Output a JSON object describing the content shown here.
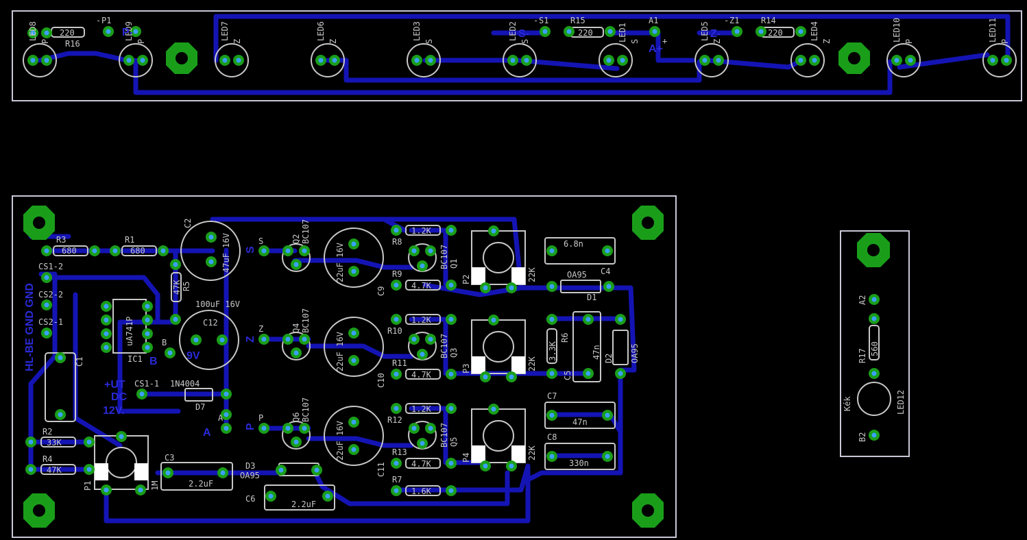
{
  "colors": {
    "background": "#000000",
    "trace": "#1414b4",
    "pad": "#1a9e1a",
    "drill": "#3aa0ff",
    "silk": "#c8c8c8",
    "outline": "#c8c8d8",
    "blue_text": "#2a2ad8"
  },
  "top_board": {
    "labels": {
      "led8": "LED8",
      "led9": "LED9",
      "led7": "LED7",
      "led6": "LED6",
      "led3": "LED3",
      "led2": "LED2",
      "led1": "LED1",
      "led5": "LED5",
      "led4": "LED4",
      "led10": "LED10",
      "led11": "LED11",
      "r16": "R16",
      "r16v": "220",
      "r15": "R15",
      "r15v": "220",
      "r14": "R14",
      "r14v": "220",
      "p1": "P1",
      "s1": "S1",
      "a1": "A1",
      "z1": "Z1",
      "p_a": "P",
      "p_b": "P",
      "p_c": "P",
      "p_d": "P",
      "z_a": "Z",
      "z_b": "Z",
      "z_c": "Z",
      "z_d": "Z",
      "s_a": "S",
      "s_b": "S",
      "s_c": "S",
      "plus": "+",
      "minus1": "-",
      "minus2": "-",
      "minus3": "-",
      "blue_p": "P-",
      "blue_s": "S-",
      "blue_a": "A+",
      "blue_z": "Z-"
    }
  },
  "main_board": {
    "labels": {
      "r3": "R3",
      "r3v": "680",
      "r1": "R1",
      "r1v": "680",
      "r5": "R5",
      "r5v": "47K",
      "c2": "C2",
      "c2v": "47uF 16V",
      "c12": "C12",
      "c12v": "100uF 16V",
      "ic1": "IC1",
      "ic1v": "uA741P",
      "cs12": "CS1-2",
      "cs22": "CS2-2",
      "cs21": "CS2-1",
      "cs11": "CS1-1",
      "c1": "C1",
      "d7": "D7",
      "d7v": "1N4004",
      "r2": "R2",
      "r2v": "33K",
      "r4": "R4",
      "r4v": "47K",
      "p1": "P1",
      "p1v": "1M",
      "c3": "C3",
      "c3v": "2.2uF",
      "d3": "D3",
      "d3v": "OA95",
      "c6": "C6",
      "c6v": "2.2uF",
      "q2": "Q2",
      "q4": "Q4",
      "q6": "Q6",
      "bc107": "BC107",
      "c9v": "22uF 16V",
      "c10v": "22uF 16V",
      "c11v": "22uF 16V",
      "c9": "C9",
      "c10": "C10",
      "c11": "C11",
      "r8": "R8",
      "r8v": "1.2K",
      "r9": "R9",
      "r9v": "4.7K",
      "r10": "R10",
      "r10v": "1.2K",
      "r11": "R11",
      "r11v": "4.7K",
      "r12": "R12",
      "r12v": "1.2K",
      "r13": "R13",
      "r13v": "4.7K",
      "r7": "R7",
      "r7v": "1.6K",
      "q1": "Q1",
      "q3": "Q3",
      "q5": "Q5",
      "p2": "P2",
      "p3": "P3",
      "p4": "P4",
      "pv": "22K",
      "c4": "C4",
      "c4v": "6.8n",
      "d1": "D1",
      "d1v": "OA95",
      "r6": "R6",
      "r6v": "3.3K",
      "c5": "C5",
      "c5v": "47n",
      "d2": "D2",
      "d2v": "OA95",
      "c7": "C7",
      "c7v": "47n",
      "c8": "C8",
      "c8v": "330n",
      "s": "S",
      "z": "Z",
      "p": "P",
      "a": "A",
      "b": "B",
      "blue_gnd": "HL-BE GND GND",
      "blue_s": "S",
      "blue_z": "Z",
      "blue_p": "P",
      "blue_a": "A",
      "blue_b": "B",
      "blue_9v": "9V",
      "blue_power": "+UT",
      "blue_dc": "DC",
      "blue_12v": "12V."
    }
  },
  "small_board": {
    "labels": {
      "a2": "A2",
      "r17": "R17",
      "r17v": "560",
      "kek": "Kék",
      "led12": "LED12",
      "b2": "B2"
    }
  }
}
